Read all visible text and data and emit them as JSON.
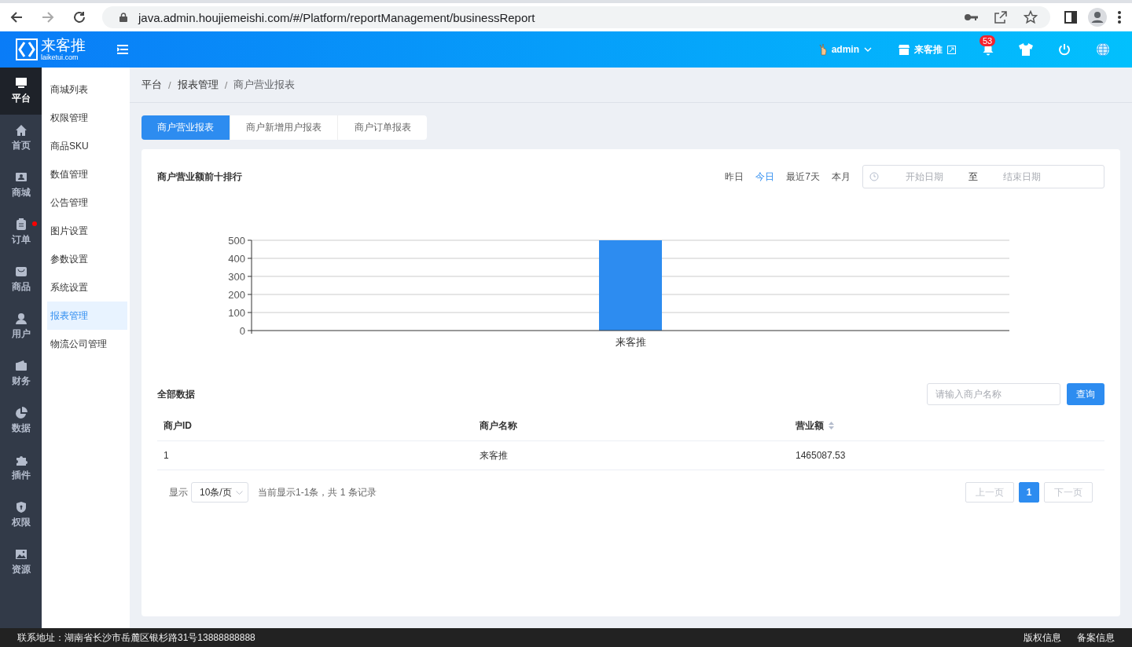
{
  "browser": {
    "url": "java.admin.houjiemeishi.com/#/Platform/reportManagement/businessReport"
  },
  "header": {
    "logo_text": "来客推",
    "logo_subtext": "laiketui.com",
    "user": "admin",
    "store": "来客推",
    "notifications": "53"
  },
  "rail": [
    {
      "label": "平台",
      "selected": true,
      "dot": false
    },
    {
      "label": "首页",
      "selected": false,
      "dot": false
    },
    {
      "label": "商城",
      "selected": false,
      "dot": false
    },
    {
      "label": "订单",
      "selected": false,
      "dot": true
    },
    {
      "label": "商品",
      "selected": false,
      "dot": false
    },
    {
      "label": "用户",
      "selected": false,
      "dot": false
    },
    {
      "label": "财务",
      "selected": false,
      "dot": false
    },
    {
      "label": "数据",
      "selected": false,
      "dot": false
    },
    {
      "label": "插件",
      "selected": false,
      "dot": false
    },
    {
      "label": "权限",
      "selected": false,
      "dot": false
    },
    {
      "label": "资源",
      "selected": false,
      "dot": false
    }
  ],
  "submenu": [
    {
      "label": "商城列表",
      "selected": false
    },
    {
      "label": "权限管理",
      "selected": false
    },
    {
      "label": "商品SKU",
      "selected": false
    },
    {
      "label": "数值管理",
      "selected": false
    },
    {
      "label": "公告管理",
      "selected": false
    },
    {
      "label": "图片设置",
      "selected": false
    },
    {
      "label": "参数设置",
      "selected": false
    },
    {
      "label": "系统设置",
      "selected": false
    },
    {
      "label": "报表管理",
      "selected": true
    },
    {
      "label": "物流公司管理",
      "selected": false
    }
  ],
  "breadcrumb": {
    "separator": "/",
    "items": [
      "平台",
      "报表管理",
      "商户营业报表"
    ]
  },
  "tabs": [
    {
      "label": "商户营业报表",
      "selected": true
    },
    {
      "label": "商户新增用户报表",
      "selected": false
    },
    {
      "label": "商户订单报表",
      "selected": false
    }
  ],
  "chart_card": {
    "title": "商户营业额前十排行",
    "quick_ranges": [
      {
        "label": "昨日",
        "selected": false
      },
      {
        "label": "今日",
        "selected": true
      },
      {
        "label": "最近7天",
        "selected": false
      },
      {
        "label": "本月",
        "selected": false
      }
    ],
    "date_range": {
      "start_placeholder": "开始日期",
      "separator": "至",
      "end_placeholder": "结束日期"
    },
    "chart_data": {
      "type": "bar",
      "categories": [
        "来客推"
      ],
      "series": [
        {
          "color": "#2d8cf0",
          "values": [
            500
          ]
        }
      ],
      "ylim": [
        0,
        500
      ],
      "yticks": [
        0,
        100,
        200,
        300,
        400,
        500
      ],
      "grid": true
    }
  },
  "table_section": {
    "title": "全部数据",
    "search": {
      "placeholder": "请输入商户名称"
    },
    "search_button": "查询",
    "columns": [
      {
        "label": "商户ID",
        "sortable": false
      },
      {
        "label": "商户名称",
        "sortable": false
      },
      {
        "label": "营业额",
        "sortable": true
      }
    ],
    "rows": [
      [
        "1",
        "来客推",
        "1465087.53"
      ]
    ],
    "pagination": {
      "show_label": "显示",
      "page_size": "10条/页",
      "summary": "当前显示1-1条，共 1 条记录",
      "prev": {
        "label": "上一页",
        "disabled": true
      },
      "pages": [
        {
          "label": "1",
          "selected": true
        }
      ],
      "next": {
        "label": "下一页",
        "disabled": true
      }
    }
  },
  "footer": {
    "address": "联系地址：湖南省长沙市岳麓区银杉路31号13888888888",
    "links": [
      "版权信息",
      "备案信息"
    ]
  }
}
